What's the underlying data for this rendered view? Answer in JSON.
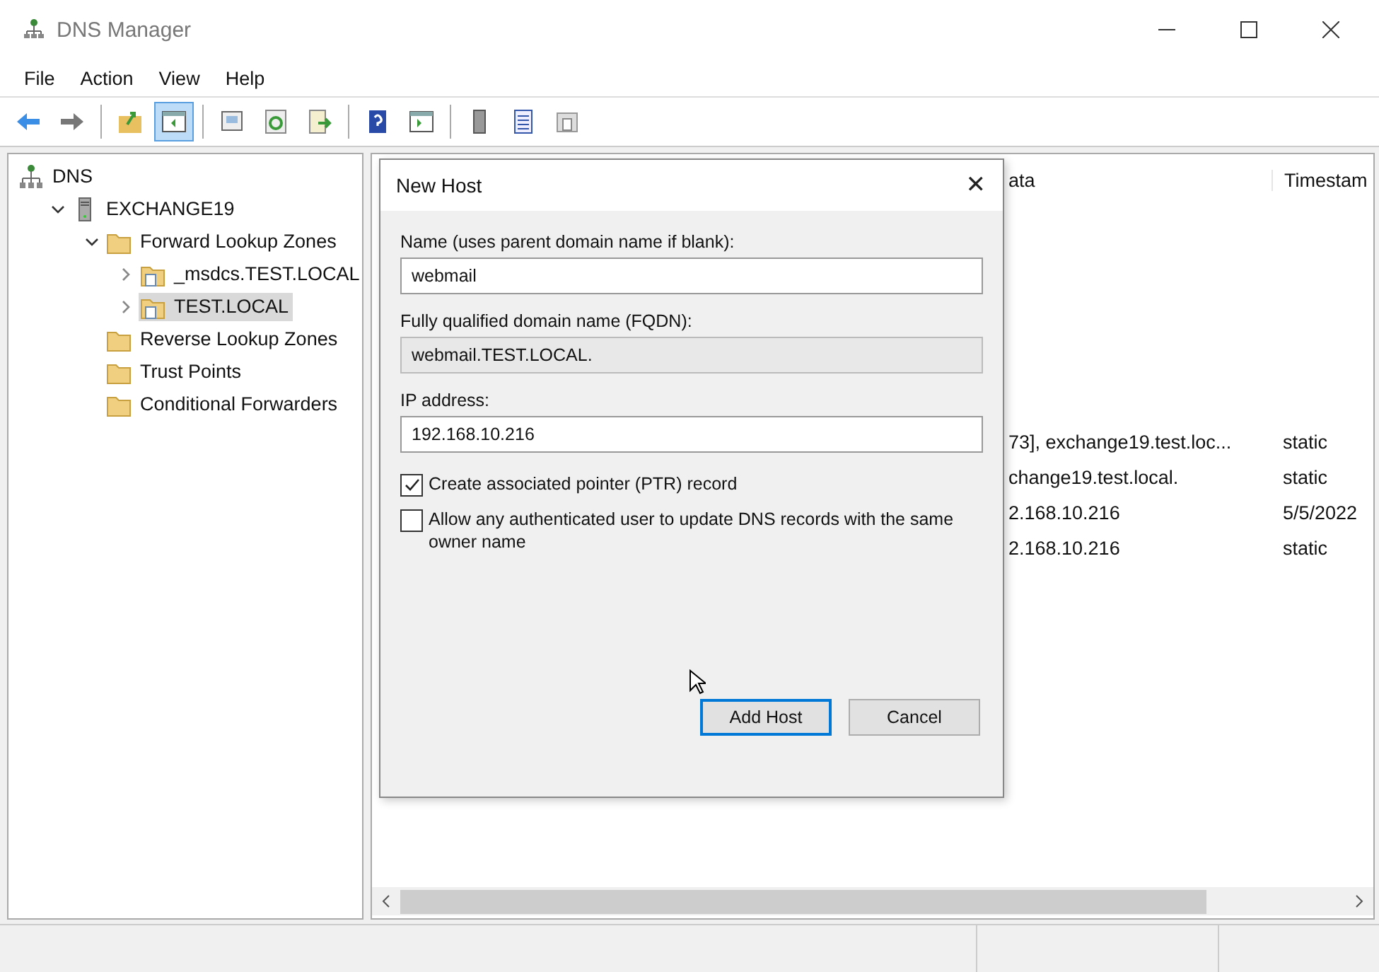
{
  "window": {
    "title": "DNS Manager"
  },
  "menu": [
    "File",
    "Action",
    "View",
    "Help"
  ],
  "toolbar": [
    {
      "kind": "back",
      "selected": false
    },
    {
      "kind": "forward",
      "selected": false
    },
    {
      "kind": "sep"
    },
    {
      "kind": "up",
      "selected": false
    },
    {
      "kind": "tree",
      "selected": true
    },
    {
      "kind": "sep"
    },
    {
      "kind": "props",
      "selected": false
    },
    {
      "kind": "refresh",
      "selected": false
    },
    {
      "kind": "export",
      "selected": false
    },
    {
      "kind": "sep"
    },
    {
      "kind": "help",
      "selected": false
    },
    {
      "kind": "pane",
      "selected": false
    },
    {
      "kind": "sep"
    },
    {
      "kind": "server",
      "selected": false
    },
    {
      "kind": "list",
      "selected": false
    },
    {
      "kind": "zone",
      "selected": false
    }
  ],
  "tree": [
    {
      "label": "DNS",
      "kind": "dns",
      "selected": false,
      "children": [
        {
          "label": "EXCHANGE19",
          "kind": "server",
          "expanded": true,
          "selected": false,
          "children": [
            {
              "label": "Forward Lookup Zones",
              "kind": "folder",
              "expanded": true,
              "selected": false,
              "children": [
                {
                  "label": "_msdcs.TEST.LOCAL",
                  "kind": "zone",
                  "expanded": false,
                  "selected": false
                },
                {
                  "label": "TEST.LOCAL",
                  "kind": "zone",
                  "expanded": false,
                  "selected": true
                }
              ]
            },
            {
              "label": "Reverse Lookup Zones",
              "kind": "folder",
              "selected": false
            },
            {
              "label": "Trust Points",
              "kind": "folder",
              "selected": false
            },
            {
              "label": "Conditional Forwarders",
              "kind": "folder",
              "selected": false
            }
          ]
        }
      ]
    }
  ],
  "list": {
    "columns": [
      "ata",
      "Timestam"
    ],
    "rows": [
      [
        "73], exchange19.test.loc...",
        "static"
      ],
      [
        "change19.test.local.",
        "static"
      ],
      [
        "2.168.10.216",
        "5/5/2022"
      ],
      [
        "2.168.10.216",
        "static"
      ]
    ]
  },
  "dialog": {
    "title": "New Host",
    "close": "✕",
    "fields": [
      {
        "label": "Name (uses parent domain name if blank):",
        "value": "webmail",
        "readonly": false
      },
      {
        "label": "Fully qualified domain name (FQDN):",
        "value": "webmail.TEST.LOCAL.",
        "readonly": true
      },
      {
        "label": "IP address:",
        "value": "192.168.10.216",
        "readonly": false
      }
    ],
    "checkboxes": [
      {
        "label": "Create associated pointer (PTR) record",
        "checked": true
      },
      {
        "label": "Allow any authenticated user to update DNS records with the same owner name",
        "checked": false
      }
    ],
    "buttons": [
      {
        "label": "Add Host",
        "default": true
      },
      {
        "label": "Cancel",
        "default": false
      }
    ]
  }
}
